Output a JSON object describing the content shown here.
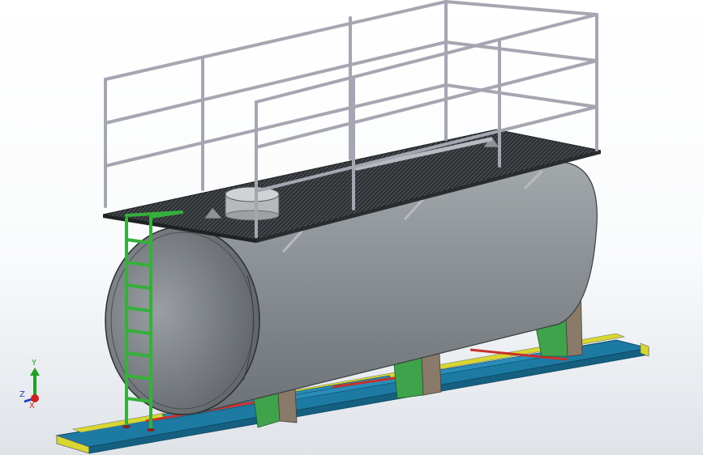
{
  "triad": {
    "x_label": "X",
    "y_label": "Y",
    "z_label": "Z",
    "x_color": "#d02020",
    "y_color": "#20a020",
    "z_color": "#2040c0"
  },
  "colors": {
    "tank": "#8c9296",
    "tank_dark": "#5d6266",
    "deck": "#3a3d40",
    "railing": "#a6a6b2",
    "ladder": "#35b03a",
    "frame_blue": "#1f7fa8",
    "frame_yellow": "#e0df2a",
    "saddle_green": "#3ea34a",
    "saddle_brown": "#8a7a6a",
    "accent_red": "#c8302a"
  }
}
